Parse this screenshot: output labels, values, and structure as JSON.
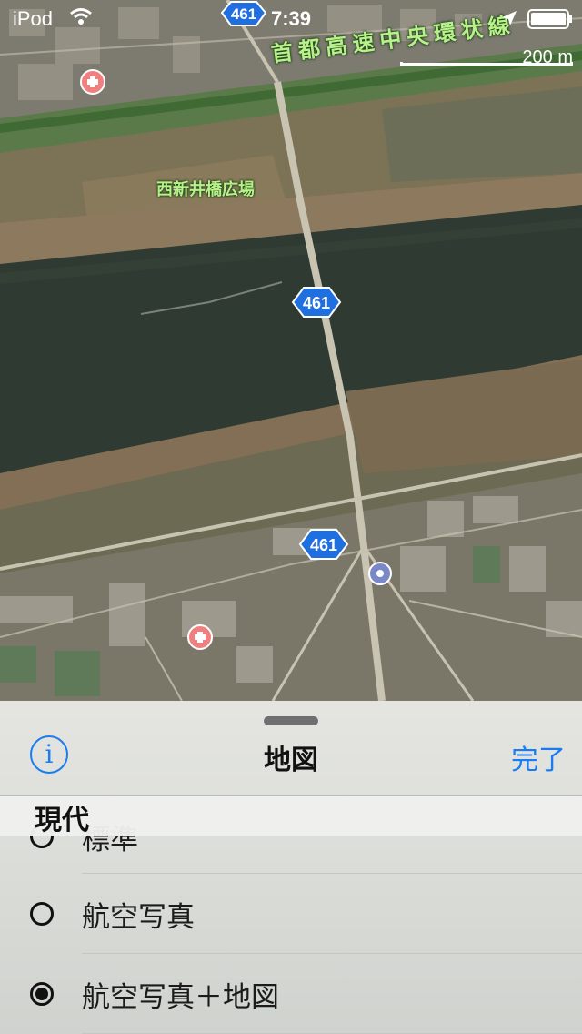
{
  "status_bar": {
    "carrier": "iPod",
    "time": "7:39"
  },
  "map": {
    "scale_label": "200 m",
    "expressway_label": "首都高速中央環状線",
    "park_label": "西新井橋広場",
    "route_shields": [
      "461",
      "461",
      "461"
    ]
  },
  "sheet": {
    "title": "地図",
    "done_label": "完了",
    "section_title": "現代",
    "options": [
      {
        "label": "標準",
        "selected": false
      },
      {
        "label": "航空写真",
        "selected": false
      },
      {
        "label": "航空写真＋地図",
        "selected": true
      }
    ]
  },
  "colors": {
    "accent": "#1a7cf2",
    "river": "#2f3a33",
    "road_label": "#b8f08a"
  }
}
